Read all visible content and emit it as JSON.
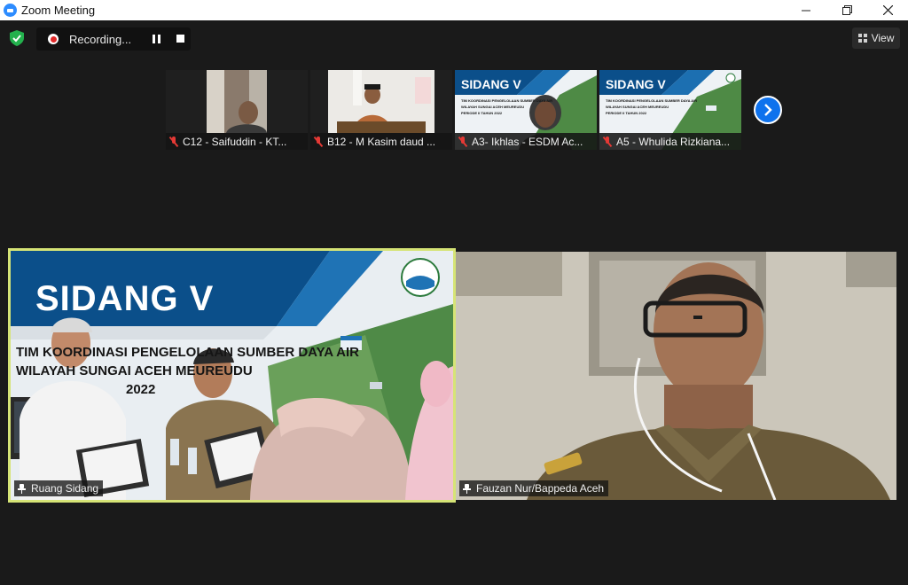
{
  "window": {
    "title": "Zoom Meeting",
    "controls": [
      "minimize",
      "maximize",
      "close"
    ]
  },
  "toolbar": {
    "recording_label": "Recording...",
    "view_label": "View"
  },
  "thumbnails": [
    {
      "name": "C12 - Saifuddin - KT...",
      "muted": true
    },
    {
      "name": "B12 - M Kasim daud ...",
      "muted": true
    },
    {
      "name": "A3- Ikhlas - ESDM Ac...",
      "muted": true,
      "slide_title": "SIDANG V",
      "slide_lines": [
        "TIM KOORDINASI PENGELOLAAN SUMBER DAYA AIR",
        "WILAYAH SUNGAI ACEH MEUREUDU",
        "PERIODE II TAHUN 2022"
      ]
    },
    {
      "name": "A5 - Whulida Rizkiana...",
      "muted": true,
      "slide_title": "SIDANG V",
      "slide_lines": [
        "TIM KOORDINASI PENGELOLAAN SUMBER DAYA AIR",
        "WILAYAH SUNGAI ACEH MEUREUDU",
        "PERIODE II TAHUN 2022"
      ]
    }
  ],
  "main_tiles": [
    {
      "name": "Ruang Sidang",
      "active_speaker": true,
      "slide_title": "SIDANG V",
      "slide_lines": [
        "TIM KOORDINASI PENGELOLAAN SUMBER DAYA AIR",
        "WILAYAH SUNGAI ACEH MEUREUDU",
        "2022"
      ]
    },
    {
      "name": "Fauzan Nur/Bappeda Aceh",
      "active_speaker": false
    }
  ],
  "colors": {
    "active_border": "#d6e476",
    "muted_icon": "#e53935",
    "next_button": "#0e72ed",
    "record_dot": "#e02828",
    "shield": "#23b14d"
  }
}
